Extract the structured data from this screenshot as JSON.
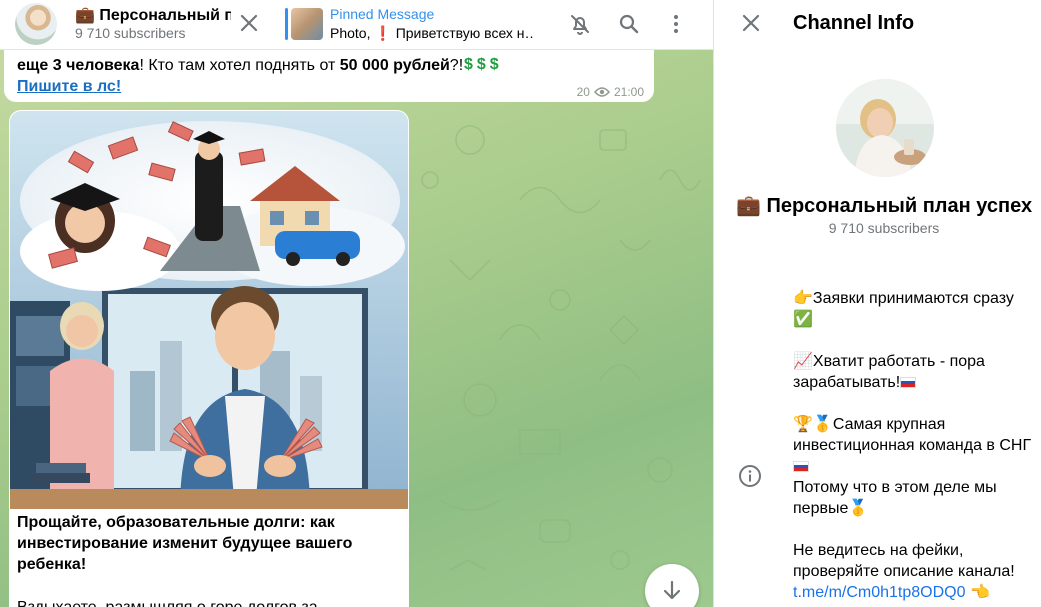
{
  "chat_header": {
    "title": "💼 Персональный пл",
    "subscribers": "9 710 subscribers",
    "pinned_title": "Pinned Message",
    "pinned_text_prefix": "Photo, ",
    "pinned_text_mark": "❗",
    "pinned_text": " Приветствую всех н…"
  },
  "message1": {
    "line1_part1": "еще 3 человека",
    "line1_part2": "! Кто там хотел поднять от ",
    "line1_part3": "50 000 рублей",
    "line1_part4": "?! ",
    "dollar_icons": "$$$",
    "link_text": "Пишите в лс!",
    "views": "20",
    "time": "21:00"
  },
  "message2": {
    "caption_title": "Прощайте, образовательные долги: как инвестирование изменит будущее вашего ребенка!",
    "caption_body": "Вздыхаете, размышляя о горе долгов за"
  },
  "panel": {
    "heading": "Channel Info",
    "channel_name": "💼 Персональный план успех…",
    "subscribers": "9 710 subscribers",
    "desc": {
      "p1_emoji": "👉",
      "p1_text": "Заявки принимаются сразу",
      "p1_end": "✅",
      "p2_emoji": "📈",
      "p2_text": "Хватит работать - пора зарабатывать!",
      "p3_emoji": "🏆🥇",
      "p3_text": "Самая крупная инвестиционная команда в СНГ",
      "p3_text2": "Потому что в этом деле мы первые",
      "p3_end": "🥇",
      "p4_text": "Не ведитесь на фейки, проверяйте описание канала!",
      "p4_link": "t.me/m/Cm0h1tp8ODQ0",
      "p4_end": "👈"
    }
  },
  "colors": {
    "accent": "#3390ec",
    "link": "#1a73e8",
    "chat_bg": "#a9cc8c",
    "secondary_text": "#707579"
  },
  "icons": [
    "close-icon",
    "bell-off-icon",
    "search-icon",
    "more-vertical-icon",
    "eye-icon",
    "arrow-down-icon",
    "info-icon"
  ]
}
